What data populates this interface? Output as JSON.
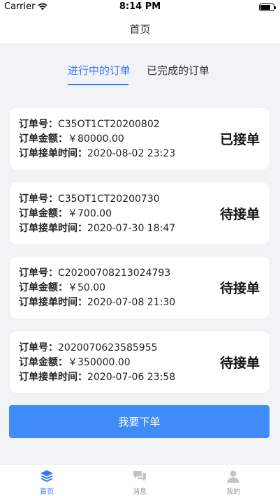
{
  "status_bar": {
    "carrier": "Carrier",
    "time": "8:14 PM",
    "battery_level": 0.8
  },
  "nav": {
    "title": "首页"
  },
  "tabs": [
    {
      "label": "进行中的订单",
      "active": true
    },
    {
      "label": "已完成的订单",
      "active": false
    }
  ],
  "labels": {
    "order_no": "订单号：",
    "amount": "订单金额：",
    "accept_time": "订单接单时间："
  },
  "orders": [
    {
      "order_no": "C35OT1CT20200802",
      "amount": "￥80000.00",
      "accept_time": "2020-08-02 23:23",
      "status": "已接单"
    },
    {
      "order_no": "C35OT1CT20200730",
      "amount": "￥700.00",
      "accept_time": "2020-07-30 18:47",
      "status": "待接单"
    },
    {
      "order_no": "C20200708213024793",
      "amount": "￥50.00",
      "accept_time": "2020-07-08 21:30",
      "status": "待接单"
    },
    {
      "order_no": "2020070623585955",
      "amount": "￥350000.00",
      "accept_time": "2020-07-06 23:58",
      "status": "待接单"
    }
  ],
  "primary_button": {
    "label": "我要下单"
  },
  "tab_bar": [
    {
      "label": "首页",
      "icon": "layers-icon",
      "active": true
    },
    {
      "label": "消息",
      "icon": "chat-icon",
      "active": false
    },
    {
      "label": "我的",
      "icon": "person-icon",
      "active": false
    }
  ],
  "colors": {
    "accent": "#3478f6",
    "button": "#3f8bf7",
    "background": "#f2f3f5"
  }
}
